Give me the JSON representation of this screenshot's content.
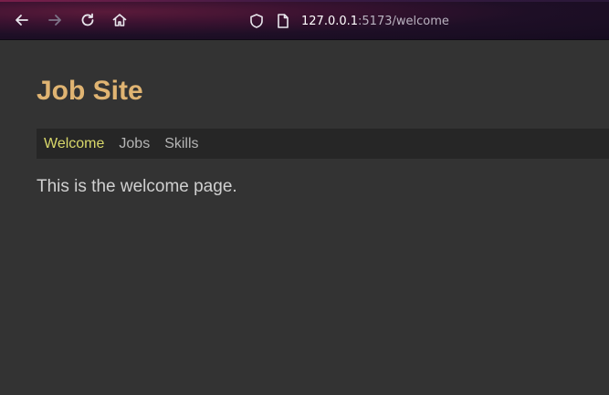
{
  "browser": {
    "url_host": "127.0.0.1",
    "url_rest": ":5173/welcome",
    "buttons": {
      "back": "arrow-left-icon",
      "forward": "arrow-right-icon",
      "reload": "reload-icon",
      "home": "home-icon"
    }
  },
  "site": {
    "title": "Job Site",
    "nav": [
      {
        "label": "Welcome",
        "active": true
      },
      {
        "label": "Jobs",
        "active": false
      },
      {
        "label": "Skills",
        "active": false
      }
    ],
    "body_text": "This is the welcome page."
  },
  "colors": {
    "page_bg": "#333333",
    "nav_bg": "#262626",
    "title": "#e0b472",
    "active_link": "#d9d86a",
    "link": "#b5b5b5",
    "body_text": "#d0d0d0"
  }
}
